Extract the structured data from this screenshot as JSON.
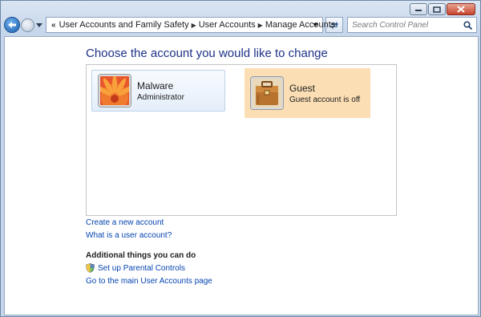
{
  "window": {
    "caption_buttons": [
      "minimize",
      "maximize",
      "close"
    ]
  },
  "nav": {
    "back_icon": "back-arrow-icon",
    "forward_icon": "forward-arrow-icon",
    "overflow": "«",
    "breadcrumb": [
      {
        "label": "User Accounts and Family Safety"
      },
      {
        "label": "User Accounts"
      },
      {
        "label": "Manage Accounts"
      }
    ],
    "search_placeholder": "Search Control Panel"
  },
  "main": {
    "title": "Choose the account you would like to change",
    "accounts": [
      {
        "name": "Malware",
        "role": "Administrator",
        "avatar": "orange-flower"
      },
      {
        "name": "Guest",
        "role": "Guest account is off",
        "avatar": "brown-briefcase"
      }
    ],
    "links": {
      "create_account": "Create a new account",
      "what_is": "What is a user account?"
    },
    "additional": {
      "heading": "Additional things you can do",
      "parental": "Set up Parental Controls",
      "main_page": "Go to the main User Accounts page"
    }
  },
  "colors": {
    "title_blue": "#1e3287",
    "link_blue": "#0645b0",
    "guest_highlight": "#fbdeb4"
  }
}
